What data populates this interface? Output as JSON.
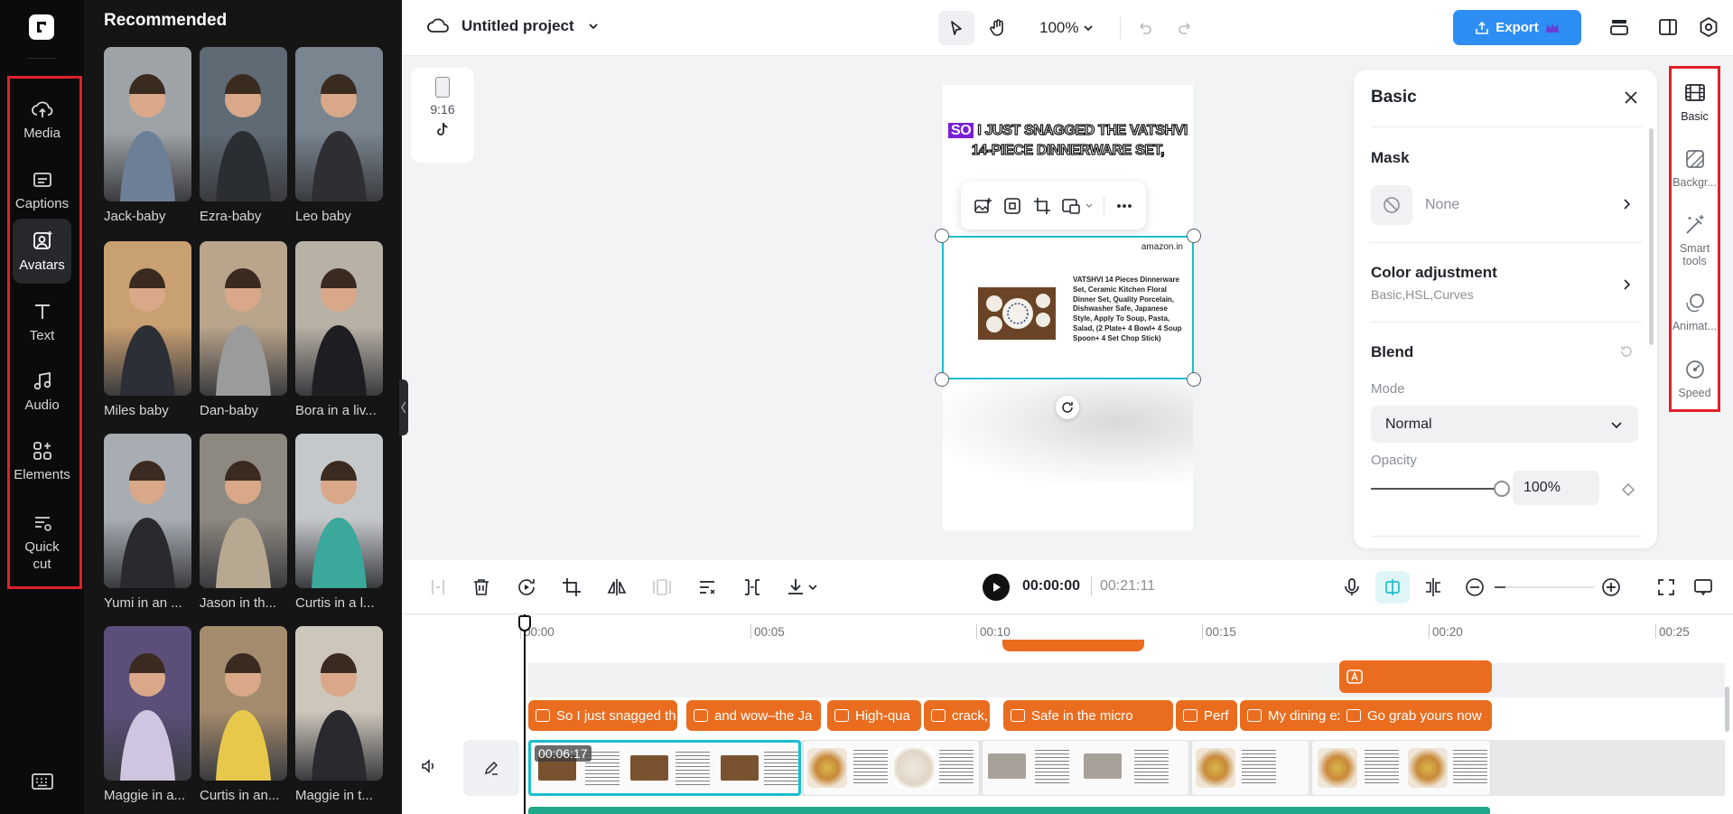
{
  "sidebar": {
    "items": [
      {
        "label": "Media",
        "icon": "cloud-upload-icon"
      },
      {
        "label": "Captions",
        "icon": "captions-icon"
      },
      {
        "label": "Avatars",
        "icon": "avatar-icon"
      },
      {
        "label": "Text",
        "icon": "text-icon"
      },
      {
        "label": "Audio",
        "icon": "music-note-icon"
      },
      {
        "label": "Elements",
        "icon": "elements-icon"
      },
      {
        "label": "Quick cut",
        "icon": "quick-cut-icon"
      }
    ],
    "active": "Avatars"
  },
  "panel": {
    "title": "Recommended",
    "avatars": [
      {
        "name": "Jack-baby",
        "bg": "#9ea3a8",
        "fg": "#6d7f96"
      },
      {
        "name": "Ezra-baby",
        "bg": "#5f6a74",
        "fg": "#2a2d32"
      },
      {
        "name": "Leo baby",
        "bg": "#7a8590",
        "fg": "#2f2f33"
      },
      {
        "name": "Miles baby",
        "bg": "#c9a071",
        "fg": "#2d2f36"
      },
      {
        "name": "Dan-baby",
        "bg": "#b9a58c",
        "fg": "#9b9b9b"
      },
      {
        "name": "Bora in a liv...",
        "bg": "#b8b1a6",
        "fg": "#1e1e22"
      },
      {
        "name": "Yumi in an ...",
        "bg": "#a7adb3",
        "fg": "#2a2a2e"
      },
      {
        "name": "Jason in th...",
        "bg": "#8d8880",
        "fg": "#b7a891"
      },
      {
        "name": "Curtis in a l...",
        "bg": "#c5c8cb",
        "fg": "#3aa89a"
      },
      {
        "name": "Maggie in a...",
        "bg": "#5b4f7a",
        "fg": "#cfc5e0"
      },
      {
        "name": "Curtis in an...",
        "bg": "#a58b6e",
        "fg": "#e8c84a"
      },
      {
        "name": "Maggie in t...",
        "bg": "#cdc6bb",
        "fg": "#2a2a2e"
      }
    ]
  },
  "topbar": {
    "project_name": "Untitled project",
    "zoom": "100%",
    "export_label": "Export"
  },
  "ratio": {
    "label": "9:16",
    "platform_icon": "tiktok-icon"
  },
  "canvas": {
    "caption_tag": "SO",
    "caption_rest": " I JUST SNAGGED THE VATSHVI 14-PIECE DINNERWARE SET,",
    "ad_brand": "amazon.in",
    "ad_text": "VATSHVI 14 Pieces Dinnerware Set, Ceramic Kitchen Floral Dinner Set, Quality Porcelain, Dishwasher Safe, Japanese Style, Apply To Soup, Pasta, Salad, (2 Plate+ 4 Bowl+ 4 Soup Spoon+ 4 Set Chop Stick)"
  },
  "properties": {
    "title": "Basic",
    "mask_label": "Mask",
    "mask_value": "None",
    "color_label": "Color adjustment",
    "color_sub": "Basic,HSL,Curves",
    "blend_label": "Blend",
    "mode_label": "Mode",
    "mode_value": "Normal",
    "opacity_label": "Opacity",
    "opacity_value": "100%",
    "opacity_level": 1.0
  },
  "right_tabs": [
    {
      "label": "Basic",
      "icon": "film-icon"
    },
    {
      "label": "Backgr...",
      "icon": "background-icon"
    },
    {
      "label": "Smart tools",
      "icon": "magic-wand-icon"
    },
    {
      "label": "Animat...",
      "icon": "animation-icon"
    },
    {
      "label": "Speed",
      "icon": "speedometer-icon"
    }
  ],
  "timeline": {
    "current_time": "00:00:00",
    "total_time": "00:21:11",
    "ruler_ticks": [
      "00:00",
      "00:05",
      "00:10",
      "00:15",
      "00:20",
      "00:25"
    ],
    "caption_clips": [
      "So I just snagged th",
      "and wow–the Ja",
      "High-qua",
      "crack,",
      "Safe in the micro",
      "Perf",
      "My dining exp",
      "Go grab yours now"
    ],
    "selected_clip_duration": "00:06:17"
  },
  "colors": {
    "accent": "#2d8ef3",
    "selection": "#1bbfcc",
    "clip_orange": "#ea6d1f",
    "highlight_red": "#e0202a"
  }
}
